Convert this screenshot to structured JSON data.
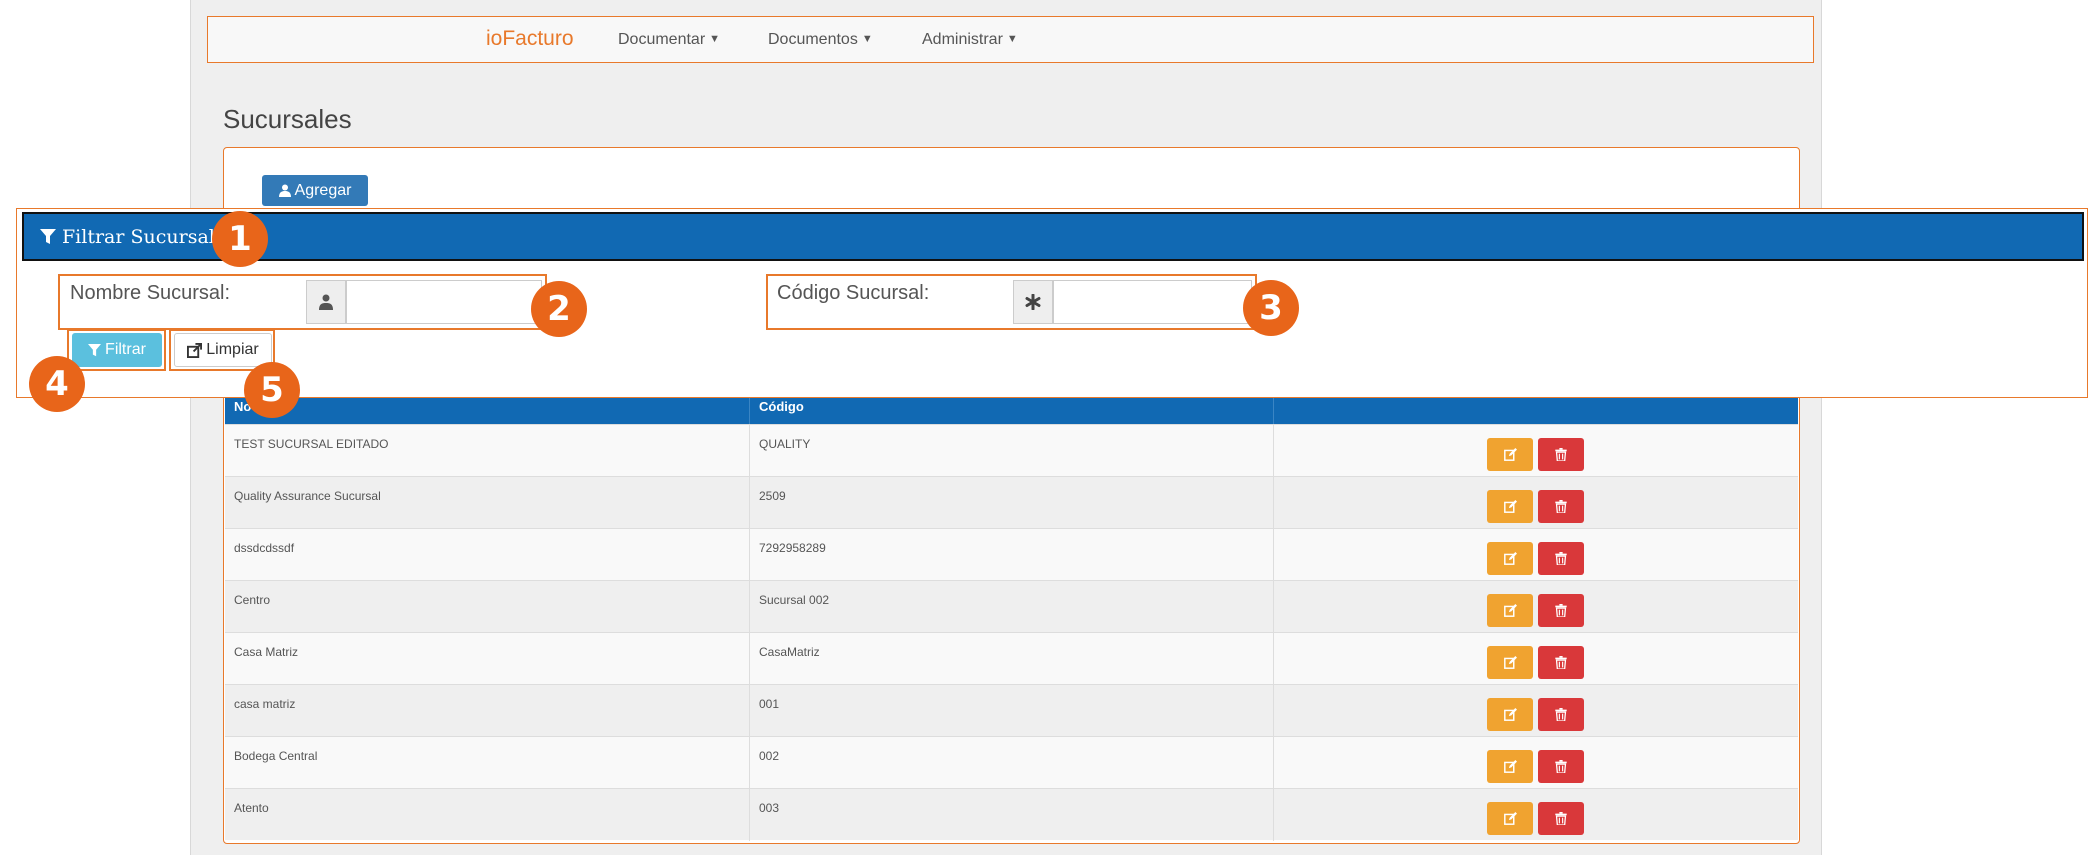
{
  "navbar": {
    "brand": "ioFacturo",
    "items": [
      {
        "label": "Documentar"
      },
      {
        "label": "Documentos"
      },
      {
        "label": "Administrar"
      }
    ]
  },
  "page": {
    "title": "Sucursales",
    "add_button": "Agregar"
  },
  "filter": {
    "title": "Filtrar Sucursales",
    "name_label": "Nombre Sucursal:",
    "name_value": "",
    "code_label": "Código Sucursal:",
    "code_value": "",
    "filter_button": "Filtrar",
    "clear_button": "Limpiar"
  },
  "callouts": [
    "1",
    "2",
    "3",
    "4",
    "5"
  ],
  "table": {
    "headers": [
      "No",
      "Código"
    ],
    "rows": [
      {
        "name": "TEST SUCURSAL EDITADO",
        "code": "QUALITY"
      },
      {
        "name": "Quality Assurance Sucursal",
        "code": "2509"
      },
      {
        "name": "dssdcdssdf",
        "code": "7292958289"
      },
      {
        "name": "Centro",
        "code": "Sucursal 002"
      },
      {
        "name": "Casa Matriz",
        "code": "CasaMatriz"
      },
      {
        "name": "casa matriz",
        "code": "001"
      },
      {
        "name": "Bodega Central",
        "code": "002"
      },
      {
        "name": "Atento",
        "code": "003"
      }
    ]
  },
  "colors": {
    "accent": "#e8792b",
    "primary": "#1169b3",
    "info": "#5bc0de",
    "warning": "#f0a330",
    "danger": "#d9383a"
  },
  "icons": [
    "user-icon",
    "filter-icon",
    "asterisk-icon",
    "share-icon",
    "edit-icon",
    "trash-icon"
  ]
}
